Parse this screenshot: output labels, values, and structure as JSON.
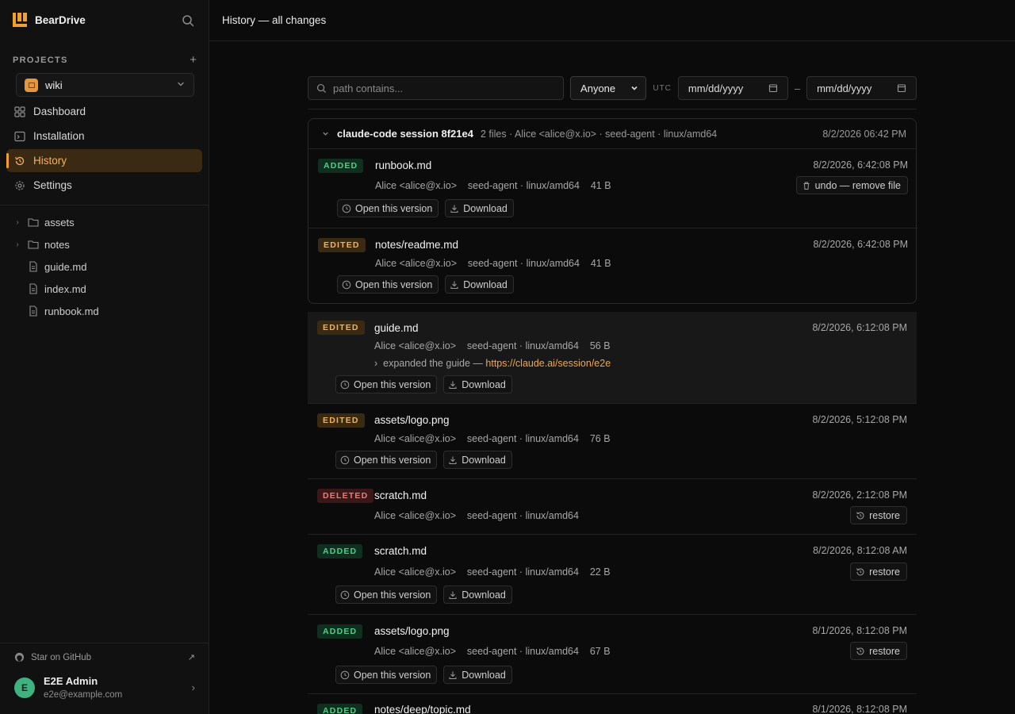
{
  "app": {
    "name": "BearDrive"
  },
  "sidebar": {
    "projects_label": "PROJECTS",
    "project": "wiki",
    "nav": [
      {
        "label": "Dashboard",
        "icon": "dashboard-icon"
      },
      {
        "label": "Installation",
        "icon": "terminal-icon"
      },
      {
        "label": "History",
        "icon": "history-icon",
        "active": true
      },
      {
        "label": "Settings",
        "icon": "gear-icon"
      }
    ],
    "tree": [
      {
        "label": "assets",
        "type": "folder"
      },
      {
        "label": "notes",
        "type": "folder"
      },
      {
        "label": "guide.md",
        "type": "file"
      },
      {
        "label": "index.md",
        "type": "file"
      },
      {
        "label": "runbook.md",
        "type": "file"
      }
    ],
    "github": "Star on GitHub",
    "user": {
      "initial": "E",
      "name": "E2E Admin",
      "email": "e2e@example.com"
    }
  },
  "header": {
    "title": "History — all changes"
  },
  "filters": {
    "path_placeholder": "path contains...",
    "author": "Anyone",
    "tz": "UTC",
    "from": "mm/dd/yyyy",
    "sep": "–",
    "to": "mm/dd/yyyy"
  },
  "labels": {
    "open": "Open this version",
    "download": "Download",
    "restore": "restore",
    "undo": "undo — remove file"
  },
  "session": {
    "title": "claude-code session 8f21e4",
    "meta": "2 files · Alice <alice@x.io> · seed-agent · linux/amd64",
    "time": "8/2/2026 06:42 PM",
    "rows": [
      {
        "badge": "ADDED",
        "file": "runbook.md",
        "meta": "Alice <alice@x.io>    seed-agent · linux/amd64    41 B",
        "time": "8/2/2026, 6:42:08 PM"
      },
      {
        "badge": "EDITED",
        "file": "notes/readme.md",
        "meta": "Alice <alice@x.io>    seed-agent · linux/amd64    41 B",
        "time": "8/2/2026, 6:42:08 PM"
      }
    ]
  },
  "entries": [
    {
      "badge": "EDITED",
      "file": "guide.md",
      "meta": "Alice <alice@x.io>    seed-agent · linux/amd64    56 B",
      "time": "8/2/2026, 6:12:08 PM",
      "note": "expanded the guide —",
      "link": "https://claude.ai/session/e2e"
    },
    {
      "badge": "EDITED",
      "file": "assets/logo.png",
      "meta": "Alice <alice@x.io>    seed-agent · linux/amd64    76 B",
      "time": "8/2/2026, 5:12:08 PM"
    },
    {
      "badge": "DELETED",
      "file": "scratch.md",
      "meta": "Alice <alice@x.io>    seed-agent · linux/amd64",
      "time": "8/2/2026, 2:12:08 PM"
    },
    {
      "badge": "ADDED",
      "file": "scratch.md",
      "meta": "Alice <alice@x.io>    seed-agent · linux/amd64    22 B",
      "time": "8/2/2026, 8:12:08 AM"
    },
    {
      "badge": "ADDED",
      "file": "assets/logo.png",
      "meta": "Alice <alice@x.io>    seed-agent · linux/amd64    67 B",
      "time": "8/1/2026, 8:12:08 PM"
    },
    {
      "badge": "ADDED",
      "file": "notes/deep/topic.md",
      "time": "8/1/2026, 8:12:08 PM"
    }
  ]
}
